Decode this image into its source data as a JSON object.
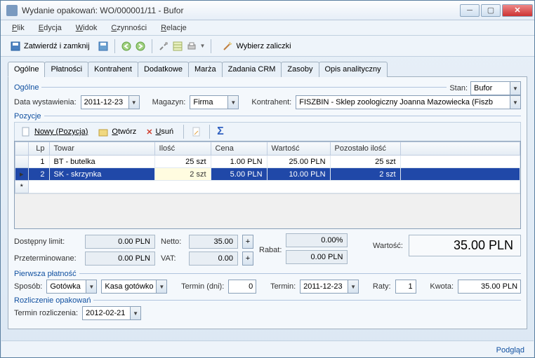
{
  "window": {
    "title": "Wydanie opakowań: WO/000001/11 - Bufor"
  },
  "menu": {
    "plik": "Plik",
    "edycja": "Edycja",
    "widok": "Widok",
    "czynnosci": "Czynności",
    "relacje": "Relacje"
  },
  "toolbar": {
    "zatwierdz": "Zatwierdź i zamknij",
    "wybierz": "Wybierz zaliczki"
  },
  "tabs": [
    "Ogólne",
    "Płatności",
    "Kontrahent",
    "Dodatkowe",
    "Marża",
    "Zadania CRM",
    "Zasoby",
    "Opis analityczny"
  ],
  "ogolne": {
    "label": "Ogólne",
    "stan_label": "Stan:",
    "stan": "Bufor",
    "data_label": "Data wystawienia:",
    "data": "2011-12-23",
    "magazyn_label": "Magazyn:",
    "magazyn": "Firma",
    "kontrahent_label": "Kontrahent:",
    "kontrahent": "FISZBIN - Sklep zoologiczny Joanna Mazowiecka (Fiszb"
  },
  "pozycje": {
    "label": "Pozycje",
    "nowy": "Nowy (Pozycja)",
    "otworz": "Otwórz",
    "usun": "Usuń",
    "cols": {
      "lp": "Lp",
      "towar": "Towar",
      "ilosc": "Ilość",
      "cena": "Cena",
      "wartosc": "Wartość",
      "pozostalo": "Pozostało ilość"
    },
    "rows": [
      {
        "lp": "1",
        "towar": "BT - butelka",
        "ilosc": "25 szt",
        "cena": "1.00 PLN",
        "wartosc": "25.00 PLN",
        "pozostalo": "25 szt"
      },
      {
        "lp": "2",
        "towar": "SK - skrzynka",
        "ilosc": "2 szt",
        "cena": "5.00 PLN",
        "wartosc": "10.00 PLN",
        "pozostalo": "2 szt"
      }
    ]
  },
  "totals": {
    "dostepny_label": "Dostępny limit:",
    "dostepny": "0.00 PLN",
    "przeterm_label": "Przeterminowane:",
    "przeterm": "0.00 PLN",
    "netto_label": "Netto:",
    "netto": "35.00",
    "vat_label": "VAT:",
    "vat": "0.00",
    "rabat_label": "Rabat:",
    "rabat_pct": "0.00%",
    "rabat_val": "0.00 PLN",
    "wartosc_label": "Wartość:",
    "wartosc": "35.00 PLN"
  },
  "platnosc": {
    "label": "Pierwsza płatność",
    "sposob_label": "Sposób:",
    "sposob": "Gotówka",
    "kasa": "Kasa gotówko",
    "termin_dni_label": "Termin (dni):",
    "termin_dni": "0",
    "termin_label": "Termin:",
    "termin": "2011-12-23",
    "raty_label": "Raty:",
    "raty": "1",
    "kwota_label": "Kwota:",
    "kwota": "35.00 PLN"
  },
  "rozliczenie": {
    "label": "Rozliczenie opakowań",
    "termin_label": "Termin rozliczenia:",
    "termin": "2012-02-21"
  },
  "footer": {
    "podglad": "Podgląd"
  }
}
